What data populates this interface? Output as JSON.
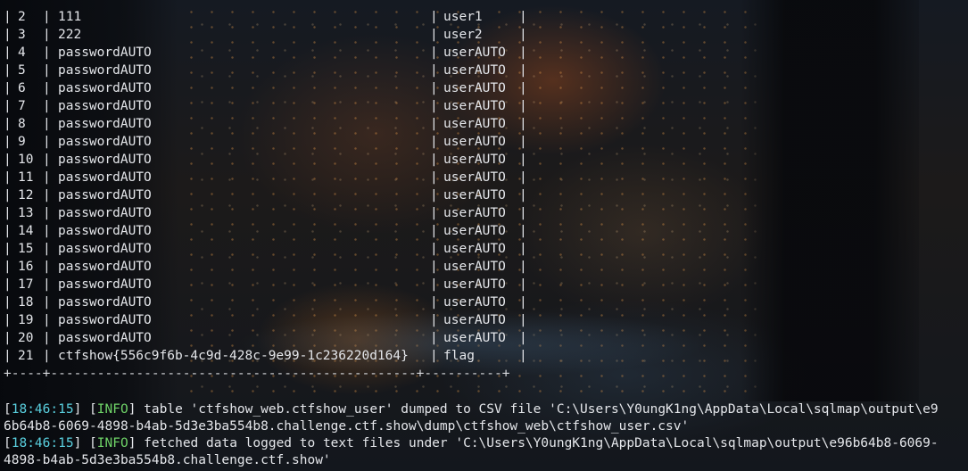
{
  "table": {
    "rows": [
      {
        "id": "2",
        "password": "111",
        "username": "user1"
      },
      {
        "id": "3",
        "password": "222",
        "username": "user2"
      },
      {
        "id": "4",
        "password": "passwordAUTO",
        "username": "userAUTO"
      },
      {
        "id": "5",
        "password": "passwordAUTO",
        "username": "userAUTO"
      },
      {
        "id": "6",
        "password": "passwordAUTO",
        "username": "userAUTO"
      },
      {
        "id": "7",
        "password": "passwordAUTO",
        "username": "userAUTO"
      },
      {
        "id": "8",
        "password": "passwordAUTO",
        "username": "userAUTO"
      },
      {
        "id": "9",
        "password": "passwordAUTO",
        "username": "userAUTO"
      },
      {
        "id": "10",
        "password": "passwordAUTO",
        "username": "userAUTO"
      },
      {
        "id": "11",
        "password": "passwordAUTO",
        "username": "userAUTO"
      },
      {
        "id": "12",
        "password": "passwordAUTO",
        "username": "userAUTO"
      },
      {
        "id": "13",
        "password": "passwordAUTO",
        "username": "userAUTO"
      },
      {
        "id": "14",
        "password": "passwordAUTO",
        "username": "userAUTO"
      },
      {
        "id": "15",
        "password": "passwordAUTO",
        "username": "userAUTO"
      },
      {
        "id": "16",
        "password": "passwordAUTO",
        "username": "userAUTO"
      },
      {
        "id": "17",
        "password": "passwordAUTO",
        "username": "userAUTO"
      },
      {
        "id": "18",
        "password": "passwordAUTO",
        "username": "userAUTO"
      },
      {
        "id": "19",
        "password": "passwordAUTO",
        "username": "userAUTO"
      },
      {
        "id": "20",
        "password": "passwordAUTO",
        "username": "userAUTO"
      },
      {
        "id": "21",
        "password": "ctfshow{556c9f6b-4c9d-428c-9e99-1c236220d164}",
        "username": "flag"
      }
    ],
    "bottom_border": "+----+-----------------------------------------------+----------+"
  },
  "logs": [
    {
      "time": "18:46:15",
      "level": "INFO",
      "line1": " table 'ctfshow_web.ctfshow_user' dumped to CSV file 'C:\\Users\\Y0ungK1ng\\AppData\\Local\\sqlmap\\output\\e9",
      "line2": "6b64b8-6069-4898-b4ab-5d3e3ba554b8.challenge.ctf.show\\dump\\ctfshow_web\\ctfshow_user.csv'"
    },
    {
      "time": "18:46:15",
      "level": "INFO",
      "line1": " fetched data logged to text files under 'C:\\Users\\Y0ungK1ng\\AppData\\Local\\sqlmap\\output\\e96b64b8-6069-",
      "line2": "4898-b4ab-5d3e3ba554b8.challenge.ctf.show'"
    }
  ],
  "colors": {
    "timestamp": "#5ad1e0",
    "info": "#6fd468",
    "text": "#e4e6ea"
  }
}
